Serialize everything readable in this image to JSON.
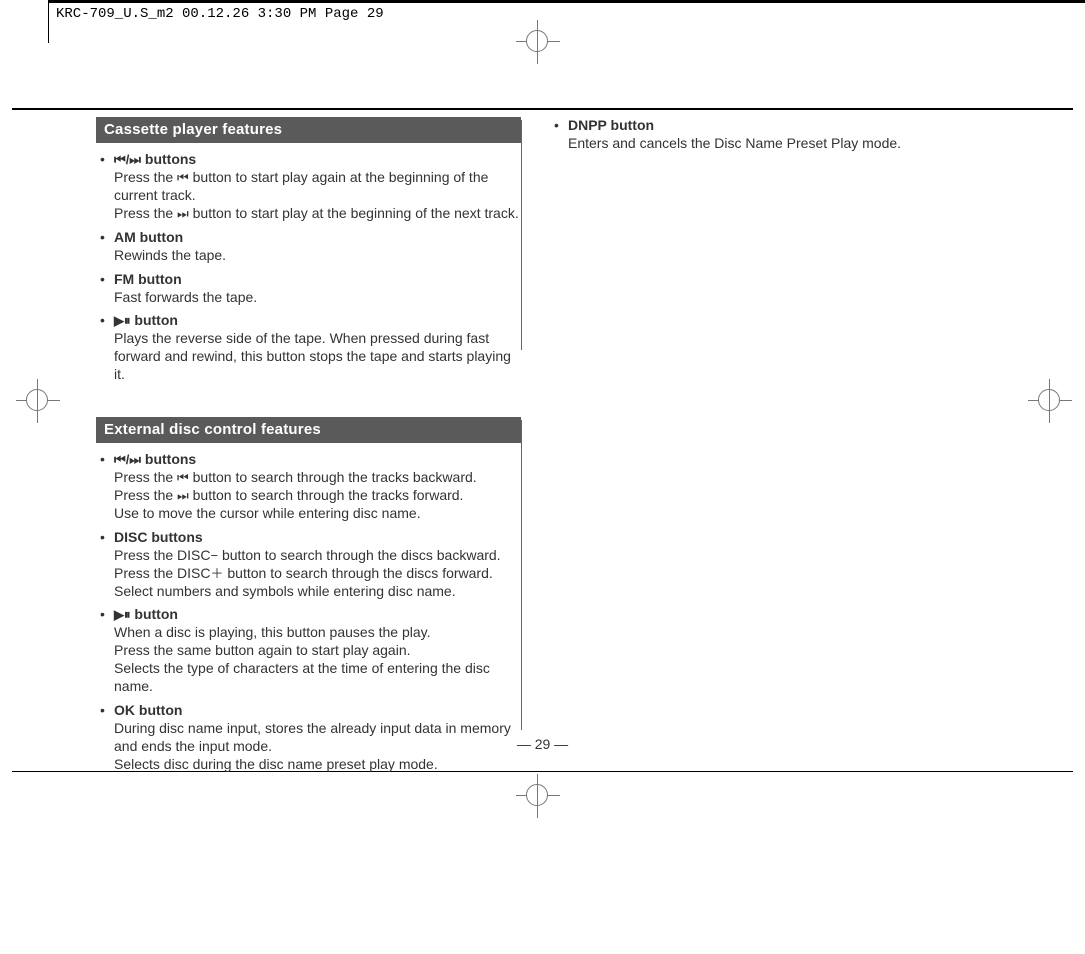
{
  "meta": {
    "header": "KRC-709_U.S_m2  00.12.26 3:30 PM  Page 29"
  },
  "page_number": "— 29 —",
  "glyphs": {
    "prev": "⏮",
    "prev_next": "⏮/⏭",
    "next": "⏭",
    "playpause": "▶⏸",
    "minus": "−",
    "plus": "＋"
  },
  "cassette": {
    "title": "Cassette player features",
    "btn_skip_title_suffix": " buttons",
    "btn_skip_l1a": "Press the ",
    "btn_skip_l1b": " button to start play again at the beginning of the current track.",
    "btn_skip_l2a": "Press the ",
    "btn_skip_l2b": " button to start play at the beginning of the next track.",
    "am_title": "AM button",
    "am_body": "Rewinds the tape.",
    "fm_title": "FM button",
    "fm_body": "Fast forwards the tape.",
    "play_title_suffix": " button",
    "play_body": "Plays the reverse side of the tape. When pressed during fast forward and rewind, this button stops the tape and starts playing it."
  },
  "disc": {
    "title": "External disc control features",
    "btn_skip_title_suffix": " buttons",
    "btn_skip_l1a": "Press the ",
    "btn_skip_l1b": " button to search through the tracks backward.",
    "btn_skip_l2a": "Press the ",
    "btn_skip_l2b": " button to search through the tracks forward.",
    "btn_skip_l3": "Use to move the cursor while entering disc name.",
    "discbtn_title": "DISC buttons",
    "discbtn_l1a": "Press the DISC",
    "discbtn_l1b": " button to search through the discs backward.",
    "discbtn_l2a": "Press the DISC",
    "discbtn_l2b": " button to search through the discs forward.",
    "discbtn_l3": "Select numbers and symbols while entering disc name.",
    "play_title_suffix": " button",
    "play_l1": "When a disc is playing, this button pauses the play.",
    "play_l2": "Press the same button again to start play again.",
    "play_l3": "Selects the type of characters at the time of entering the disc name.",
    "ok_title": "OK button",
    "ok_l1": "During disc name input, stores the already input data in memory and ends the input mode.",
    "ok_l2": "Selects disc during the disc name preset play mode."
  },
  "right": {
    "dnpp_title": "DNPP button",
    "dnpp_body": "Enters and cancels the Disc Name Preset Play mode."
  }
}
